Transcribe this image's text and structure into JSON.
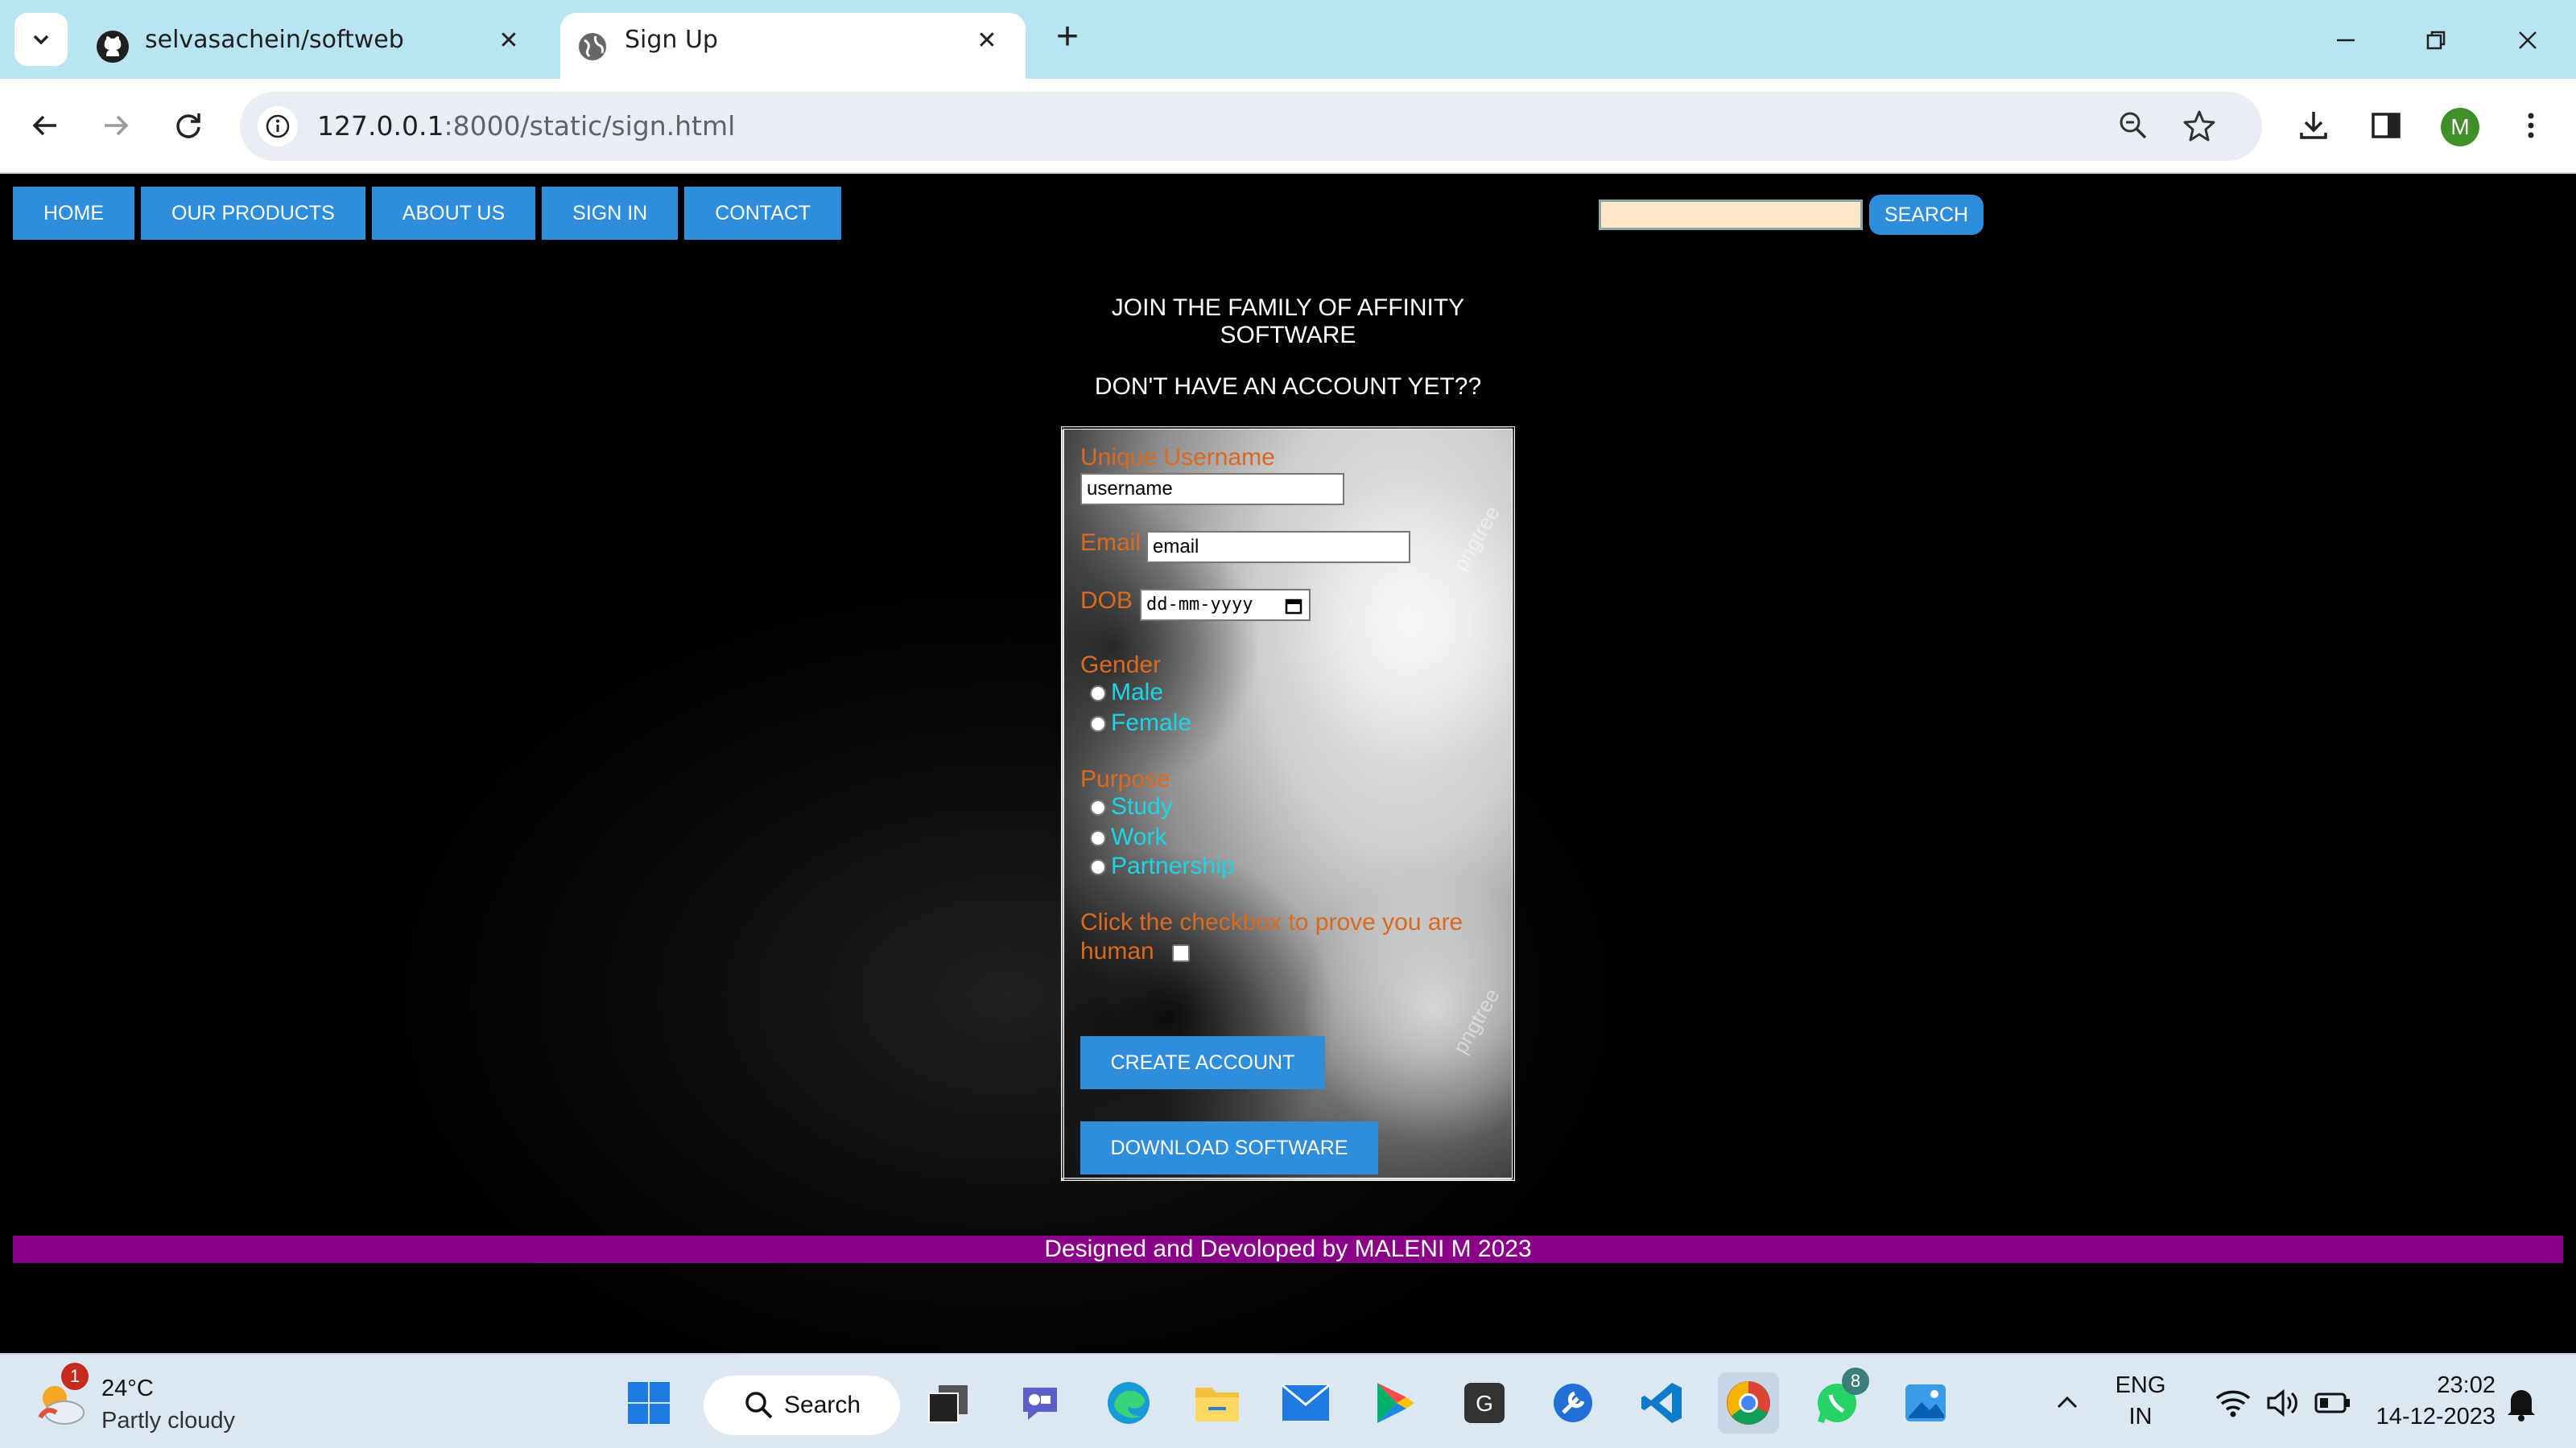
{
  "browser": {
    "tabs": [
      {
        "title": "selvasachein/softweb",
        "active": false,
        "icon": "github-icon"
      },
      {
        "title": "Sign Up",
        "active": true,
        "icon": "globe-icon"
      }
    ],
    "url_host": "127.0.0.1",
    "url_rest": ":8000/static/sign.html",
    "profile_initial": "M"
  },
  "site": {
    "nav": [
      "HOME",
      "OUR PRODUCTS",
      "ABOUT US",
      "SIGN IN",
      "CONTACT"
    ],
    "search_button": "SEARCH",
    "search_value": "",
    "headline_line1": "JOIN THE FAMILY OF AFFINITY",
    "headline_line2": "SOFTWARE",
    "subheadline": "DON'T HAVE AN ACCOUNT YET??",
    "form": {
      "username_label": "Unique Username",
      "username_placeholder": "username",
      "email_label": "Email",
      "email_placeholder": "email",
      "dob_label": "DOB",
      "dob_placeholder": "dd-mm-yyyy",
      "gender_label": "Gender",
      "gender_options": [
        "Male",
        "Female"
      ],
      "purpose_label": "Purpose",
      "purpose_options": [
        "Study",
        "Work",
        "Partnership"
      ],
      "human_label_line1": "Click the checkbox to prove you are",
      "human_label_line2": "human",
      "create_button": "CREATE ACCOUNT",
      "download_button": "DOWNLOAD SOFTWARE",
      "watermark": "pngtree"
    },
    "footer": "Designed and Devoloped by MALENI M 2023",
    "colors": {
      "nav_button": "#2f8edc",
      "label": "#d96a1e",
      "option": "#19d5e8",
      "footer": "#8a0088",
      "search_box": "#ffe6c6"
    }
  },
  "taskbar": {
    "weather_temp": "24°C",
    "weather_cond": "Partly cloudy",
    "weather_badge": "1",
    "search_label": "Search",
    "whatsapp_badge": "8",
    "lang_line1": "ENG",
    "lang_line2": "IN",
    "time": "23:02",
    "date": "14-12-2023"
  }
}
